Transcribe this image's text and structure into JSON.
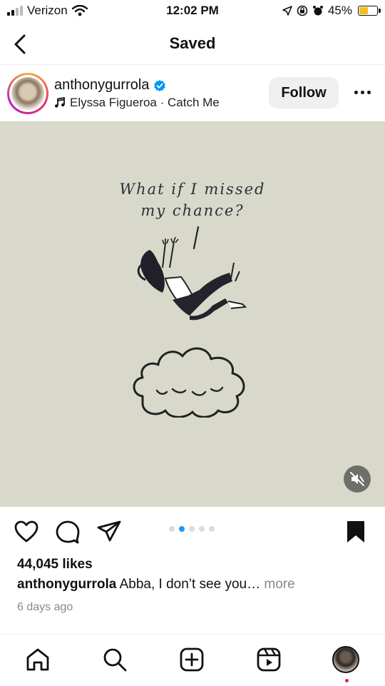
{
  "status_bar": {
    "carrier": "Verizon",
    "time": "12:02 PM",
    "battery_percent": "45%",
    "battery_level": 0.45,
    "icons": [
      "signal-icon",
      "wifi-icon",
      "location-arrow-icon",
      "screen-lock-icon",
      "alarm-icon",
      "battery-icon"
    ]
  },
  "header": {
    "title": "Saved",
    "back_icon": "chevron-left-icon"
  },
  "post": {
    "username": "anthonygurrola",
    "verified": true,
    "music": "Elyssa Figueroa · Catch Me",
    "follow_label": "Follow",
    "image_text_line1": "What if I missed",
    "image_text_line2": "my chance?",
    "image_background": "#d9d9cb",
    "carousel_count": 5,
    "carousel_active_index": 1,
    "likes": "44,045 likes",
    "caption_user": "anthonygurrola",
    "caption_text": " Abba, I don’t see you…",
    "caption_more": " more",
    "time_ago": "6 days ago"
  },
  "actions": [
    "heart-icon",
    "comment-icon",
    "share-icon",
    "bookmark-icon"
  ],
  "bottom_nav": [
    "home-icon",
    "search-icon",
    "create-icon",
    "reels-icon",
    "profile-avatar"
  ],
  "colors": {
    "accent_blue": "#2196f3",
    "verified_blue": "#0095f6",
    "notification_red": "#e0245e"
  }
}
